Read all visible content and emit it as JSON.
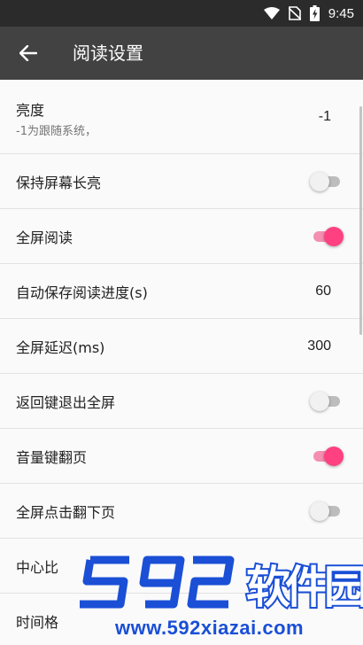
{
  "status_bar": {
    "time": "9:45"
  },
  "app_bar": {
    "title": "阅读设置"
  },
  "settings": {
    "brightness": {
      "label": "亮度",
      "sub": "-1为跟随系统，",
      "value": "-1"
    },
    "keep_screen_on": {
      "label": "保持屏幕长亮",
      "enabled": false
    },
    "fullscreen_read": {
      "label": "全屏阅读",
      "enabled": true
    },
    "autosave_progress": {
      "label": "自动保存阅读进度(s)",
      "value": "60"
    },
    "fullscreen_delay": {
      "label": "全屏延迟(ms)",
      "value": "300"
    },
    "back_exit_fullscreen": {
      "label": "返回键退出全屏",
      "enabled": false
    },
    "volume_key_flip": {
      "label": "音量键翻页",
      "enabled": true
    },
    "fullscreen_tap_next": {
      "label": "全屏点击翻下页",
      "enabled": false
    },
    "center_row": {
      "label": "中心比"
    },
    "time_row": {
      "label": "时间格"
    }
  },
  "watermark": {
    "brand": "592软件园",
    "url": "www.592xiazai.com"
  },
  "colors": {
    "app_bar": "#424242",
    "status_bar": "#2b2b2b",
    "accent": "#ff4081",
    "accent_track": "#f48fb1",
    "watermark": "#1a4fd6"
  }
}
